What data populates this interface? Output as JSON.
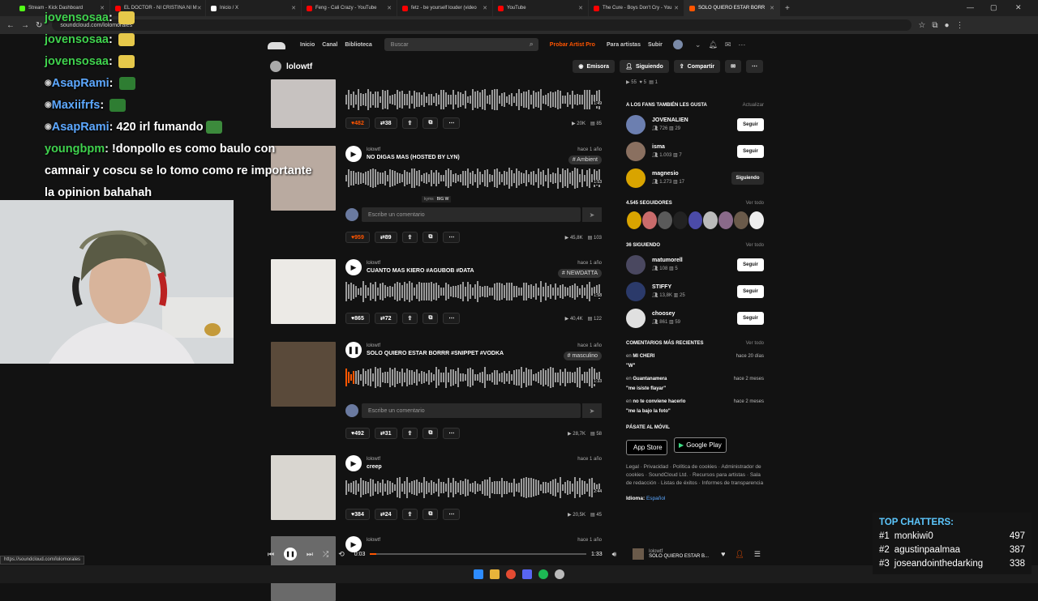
{
  "browser": {
    "tabs": [
      {
        "title": "Stream - Kick Dashboard",
        "color": "#53fc18"
      },
      {
        "title": "EL DOCTOR - NI CRISTINA NI M",
        "color": "#ff0000"
      },
      {
        "title": "Inicio / X",
        "color": "#ffffff"
      },
      {
        "title": "Feng - Cali Crazy - YouTube",
        "color": "#ff0000"
      },
      {
        "title": "fetz - be yourself louder (video",
        "color": "#ff0000"
      },
      {
        "title": "YouTube",
        "color": "#ff0000"
      },
      {
        "title": "The Cure - Boys Don't Cry - You",
        "color": "#ff0000"
      },
      {
        "title": "SOLO QUIERO ESTAR BORR",
        "color": "#ff5500",
        "active": true
      }
    ],
    "url": "soundcloud.com/lolo​morales",
    "status_url": "https://soundcloud.com/lolomorales"
  },
  "sc_header": {
    "nav": [
      "Inicio",
      "Canal",
      "Biblioteca"
    ],
    "search_placeholder": "Buscar",
    "artist_pro": "Probar Artist Pro",
    "for_artists": "Para artistas",
    "upload": "Subir"
  },
  "profile": {
    "name": "lolowtf",
    "buttons": {
      "station": "Emisora",
      "following": "Siguiendo",
      "share": "Compartir"
    }
  },
  "tracks": [
    {
      "likes": "482",
      "reposts": "38",
      "plays": "20K",
      "comments": "85",
      "liked": true,
      "time_end": "1:49"
    },
    {
      "artist": "lolowtf",
      "title": "NO DIGAS MAS (HOSTED BY LYN)",
      "ago": "hace 1 año",
      "tag": "# Ambient",
      "likes": "959",
      "reposts": "89",
      "plays": "45,8K",
      "comments": "103",
      "liked": true,
      "comment_placeholder": "Escribe un comentario",
      "time_end": "1:53",
      "wave_comment_user": "kyms",
      "wave_comment_text": "BIG W"
    },
    {
      "artist": "lolowtf",
      "title": "CUANTO MAS KIERO #AGUBOB #DATA",
      "ago": "hace 1 año",
      "tag": "# NEWDATTA",
      "likes": "865",
      "reposts": "72",
      "plays": "40,4K",
      "comments": "122",
      "time_end": "1:58"
    },
    {
      "artist": "lolowtf",
      "title": "SOLO QUIERO ESTAR BORRR #SNIPPET #VODKA",
      "ago": "hace 1 año",
      "tag": "# masculino",
      "likes": "492",
      "reposts": "31",
      "plays": "28,7K",
      "comments": "58",
      "comment_placeholder": "Escribe un comentario",
      "time_end": "1:33",
      "progress": 0.03
    },
    {
      "artist": "lolowtf",
      "title": "creep",
      "ago": "hace 1 año",
      "likes": "384",
      "reposts": "24",
      "plays": "20,5K",
      "comments": "45",
      "time_end": "2:44"
    },
    {
      "artist": "lolowtf",
      "ago": "hace 1 año"
    }
  ],
  "sidebar": {
    "top_stats": {
      "plays": "55",
      "likes": "5",
      "comments": "1"
    },
    "fans_also_like": {
      "title": "A LOS FANS TAMBIÉN LES GUSTA",
      "action": "Actualizar",
      "users": [
        {
          "name": "JOVENALIEN",
          "followers": "726",
          "tracks": "29",
          "button": "Seguir"
        },
        {
          "name": "isma",
          "followers": "1.003",
          "tracks": "7",
          "button": "Seguir"
        },
        {
          "name": "magnesio",
          "followers": "1.273",
          "tracks": "17",
          "button": "Siguiendo"
        }
      ]
    },
    "followers": {
      "title": "4.545 SEGUIDORES",
      "action": "Ver todo"
    },
    "following": {
      "title": "36 SIGUIENDO",
      "action": "Ver todo",
      "users": [
        {
          "name": "matumorell",
          "followers": "108",
          "tracks": "5",
          "button": "Seguir"
        },
        {
          "name": "STIFFY",
          "followers": "13,8K",
          "tracks": "25",
          "button": "Seguir"
        },
        {
          "name": "choosey",
          "followers": "861",
          "tracks": "59",
          "button": "Seguir"
        }
      ]
    },
    "recent_comments": {
      "title": "COMENTARIOS MÁS RECIENTES",
      "action": "Ver todo",
      "items": [
        {
          "prefix": "en",
          "track": "MI CHERI",
          "ago": "hace 20 días",
          "text": "\"W\""
        },
        {
          "prefix": "en",
          "track": "Guantanamera",
          "ago": "hace 2 meses",
          "text": "\"me isiste flayar\""
        },
        {
          "prefix": "en",
          "track": "no te conviene hacerlo",
          "ago": "hace 2 meses",
          "text": "\"me la bajo la foto\""
        }
      ]
    },
    "mobile": {
      "title": "PÁSATE AL MÓVIL",
      "app_store": "App Store",
      "google_play": "Google Play"
    },
    "footer_links": "Legal · Privacidad · Política de cookies · Administrador de cookies · SoundCloud Ltd. · Recursos para artistas · Sala de redacción · Listas de éxitos · Informes de transparencia",
    "language_label": "Idioma:",
    "language": "Español"
  },
  "player": {
    "current": "0:03",
    "duration": "1:33",
    "artist": "lolowtf",
    "title": "SOLO QUIERO ESTAR B...",
    "progress": 0.03
  },
  "chat": [
    {
      "user": "jovensosaa",
      "text": "",
      "color": "#3fd14d"
    },
    {
      "user": "jovensosaa",
      "text": "",
      "color": "#3fd14d"
    },
    {
      "user": "jovensosaa",
      "text": "",
      "color": "#3fd14d"
    },
    {
      "user": "AsapRami",
      "text": "",
      "color": "#5da8ff"
    },
    {
      "user": "Maxiifrfs",
      "text": "",
      "color": "#5da8ff"
    },
    {
      "user": "AsapRami",
      "text": "420 irl fumando",
      "color": "#5da8ff"
    },
    {
      "user": "youngbpm",
      "text": "!donpollo es como baulo con",
      "color": "#3fd14d"
    },
    {
      "user": "",
      "text": "camnair y coscu se lo tomo como re importante",
      "color": "#fff"
    },
    {
      "user": "",
      "text": "la opinion bahahah",
      "color": "#fff"
    }
  ],
  "top_chatters": {
    "title": "TOP CHATTERS:",
    "rows": [
      {
        "rank": "#1",
        "name": "monkiwi0",
        "count": "497"
      },
      {
        "rank": "#2",
        "name": "agustinpaalmaa",
        "count": "387"
      },
      {
        "rank": "#3",
        "name": "joseandointhedarking",
        "count": "338"
      }
    ]
  }
}
